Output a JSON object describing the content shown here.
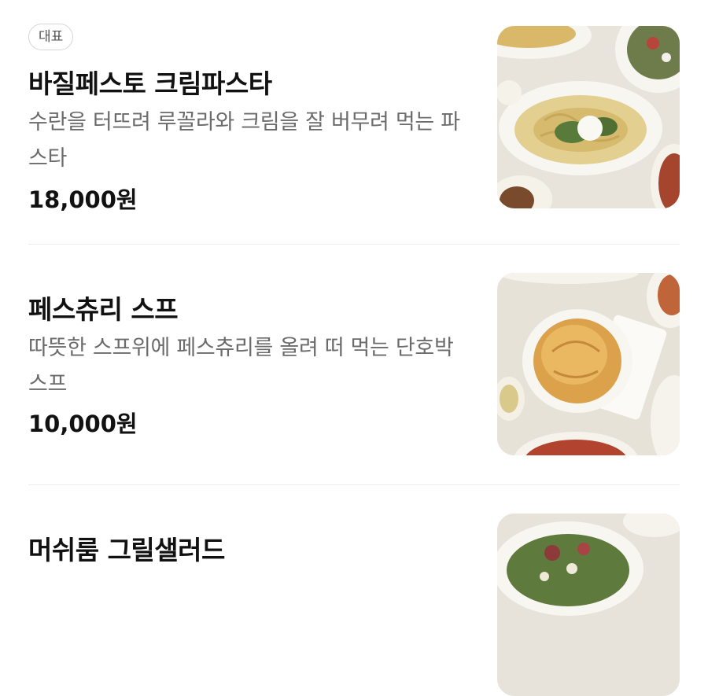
{
  "menu": {
    "items": [
      {
        "badge": "대표",
        "name": "바질페스토 크림파스타",
        "description": "수란을 터뜨려 루꼴라와 크림을 잘 버무려 먹는 파스타",
        "price": "18,000원"
      },
      {
        "name": "페스츄리 스프",
        "description": "따뜻한 스프위에 페스츄리를 올려 떠 먹는 단호박스프",
        "price": "10,000원"
      },
      {
        "name": "머쉬룸 그릴샐러드"
      }
    ]
  }
}
